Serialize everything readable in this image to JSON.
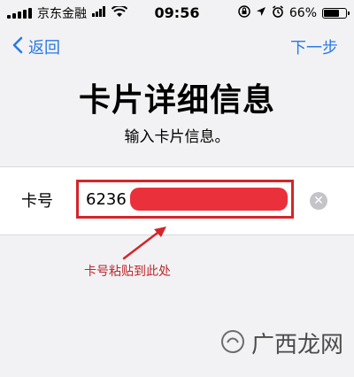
{
  "status_bar": {
    "carrier": "京东金融",
    "time": "09:56",
    "battery": "66%",
    "battery_level": 0.66,
    "icons": [
      "signal-icon",
      "wifi-icon",
      "orientation-lock-icon",
      "location-icon",
      "alarm-icon",
      "battery-icon"
    ]
  },
  "nav": {
    "back_label": "返回",
    "next_label": "下一步"
  },
  "header": {
    "title": "卡片详细信息",
    "subtitle": "输入卡片信息。"
  },
  "form": {
    "card_label": "卡号",
    "card_value": "6236",
    "annotation": "卡号粘贴到此处"
  },
  "watermark": {
    "text": "广西龙网"
  },
  "colors": {
    "accent": "#2a7ae4",
    "annotation": "#d3252a",
    "background": "#f2f2f4"
  }
}
